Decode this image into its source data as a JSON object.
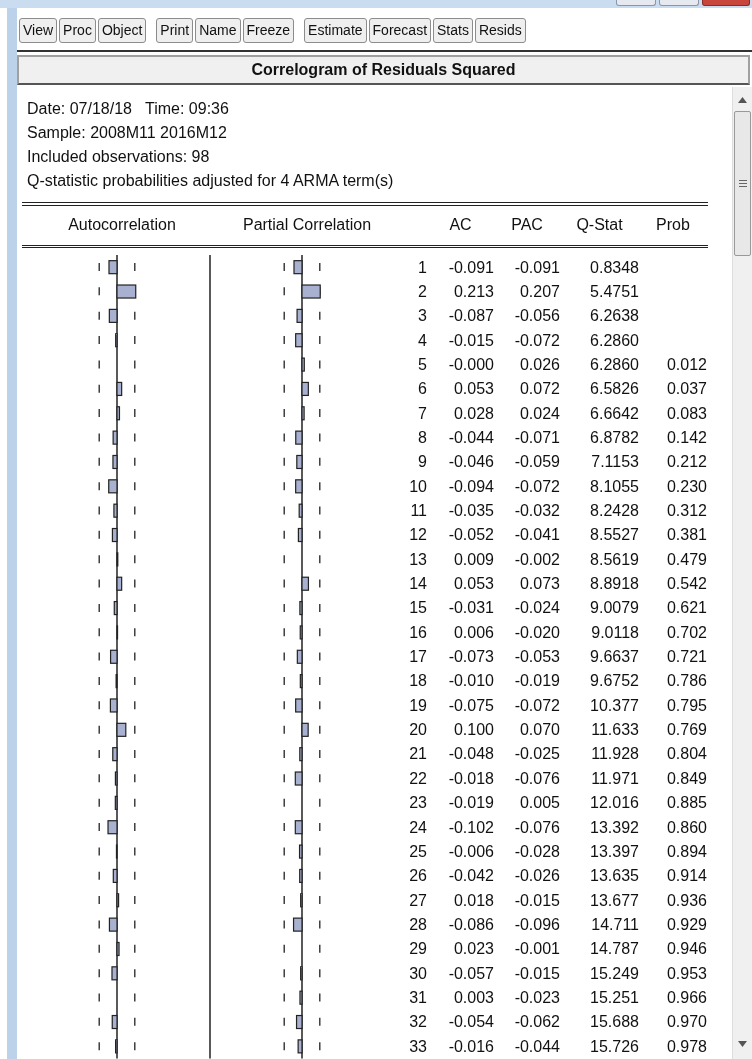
{
  "toolbar": {
    "groups": [
      [
        "View",
        "Proc",
        "Object"
      ],
      [
        "Print",
        "Name",
        "Freeze"
      ],
      [
        "Estimate",
        "Forecast",
        "Stats",
        "Resids"
      ]
    ]
  },
  "title": "Correlogram of Residuals Squared",
  "info": [
    "Date: 07/18/18   Time: 09:36",
    "Sample: 2008M11 2016M12",
    "Included observations: 98",
    "Q-statistic probabilities adjusted for 4 ARMA term(s)"
  ],
  "columns": [
    "Autocorrelation",
    "Partial Correlation",
    "AC",
    "PAC",
    "Q-Stat",
    "Prob"
  ],
  "rows": [
    {
      "lag": "1",
      "ac": "-0.091",
      "pac": "-0.091",
      "q_stat": "0.8348"
    },
    {
      "lag": "2",
      "ac": "0.213",
      "pac": "0.207",
      "q_stat": "5.4751"
    },
    {
      "lag": "3",
      "ac": "-0.087",
      "pac": "-0.056",
      "q_stat": "6.2638"
    },
    {
      "lag": "4",
      "ac": "-0.015",
      "pac": "-0.072",
      "q_stat": "6.2860"
    },
    {
      "lag": "5",
      "ac": "-0.000",
      "pac": "0.026",
      "q_stat": "6.2860",
      "prob": "0.012"
    },
    {
      "lag": "6",
      "ac": "0.053",
      "pac": "0.072",
      "q_stat": "6.5826",
      "prob": "0.037"
    },
    {
      "lag": "7",
      "ac": "0.028",
      "pac": "0.024",
      "q_stat": "6.6642",
      "prob": "0.083"
    },
    {
      "lag": "8",
      "ac": "-0.044",
      "pac": "-0.071",
      "q_stat": "6.8782",
      "prob": "0.142"
    },
    {
      "lag": "9",
      "ac": "-0.046",
      "pac": "-0.059",
      "q_stat": "7.1153",
      "prob": "0.212"
    },
    {
      "lag": "10",
      "ac": "-0.094",
      "pac": "-0.072",
      "q_stat": "8.1055",
      "prob": "0.230"
    },
    {
      "lag": "11",
      "ac": "-0.035",
      "pac": "-0.032",
      "q_stat": "8.2428",
      "prob": "0.312"
    },
    {
      "lag": "12",
      "ac": "-0.052",
      "pac": "-0.041",
      "q_stat": "8.5527",
      "prob": "0.381"
    },
    {
      "lag": "13",
      "ac": "0.009",
      "pac": "-0.002",
      "q_stat": "8.5619",
      "prob": "0.479"
    },
    {
      "lag": "14",
      "ac": "0.053",
      "pac": "0.073",
      "q_stat": "8.8918",
      "prob": "0.542"
    },
    {
      "lag": "15",
      "ac": "-0.031",
      "pac": "-0.024",
      "q_stat": "9.0079",
      "prob": "0.621"
    },
    {
      "lag": "16",
      "ac": "0.006",
      "pac": "-0.020",
      "q_stat": "9.0118",
      "prob": "0.702"
    },
    {
      "lag": "17",
      "ac": "-0.073",
      "pac": "-0.053",
      "q_stat": "9.6637",
      "prob": "0.721"
    },
    {
      "lag": "18",
      "ac": "-0.010",
      "pac": "-0.019",
      "q_stat": "9.6752",
      "prob": "0.786"
    },
    {
      "lag": "19",
      "ac": "-0.075",
      "pac": "-0.072",
      "q_stat": "10.377",
      "prob": "0.795"
    },
    {
      "lag": "20",
      "ac": "0.100",
      "pac": "0.070",
      "q_stat": "11.633",
      "prob": "0.769"
    },
    {
      "lag": "21",
      "ac": "-0.048",
      "pac": "-0.025",
      "q_stat": "11.928",
      "prob": "0.804"
    },
    {
      "lag": "22",
      "ac": "-0.018",
      "pac": "-0.076",
      "q_stat": "11.971",
      "prob": "0.849"
    },
    {
      "lag": "23",
      "ac": "-0.019",
      "pac": "0.005",
      "q_stat": "12.016",
      "prob": "0.885"
    },
    {
      "lag": "24",
      "ac": "-0.102",
      "pac": "-0.076",
      "q_stat": "13.392",
      "prob": "0.860"
    },
    {
      "lag": "25",
      "ac": "-0.006",
      "pac": "-0.028",
      "q_stat": "13.397",
      "prob": "0.894"
    },
    {
      "lag": "26",
      "ac": "-0.042",
      "pac": "-0.026",
      "q_stat": "13.635",
      "prob": "0.914"
    },
    {
      "lag": "27",
      "ac": "0.018",
      "pac": "-0.015",
      "q_stat": "13.677",
      "prob": "0.936"
    },
    {
      "lag": "28",
      "ac": "-0.086",
      "pac": "-0.096",
      "q_stat": "14.711",
      "prob": "0.929"
    },
    {
      "lag": "29",
      "ac": "0.023",
      "pac": "-0.001",
      "q_stat": "14.787",
      "prob": "0.946"
    },
    {
      "lag": "30",
      "ac": "-0.057",
      "pac": "-0.015",
      "q_stat": "15.249",
      "prob": "0.953"
    },
    {
      "lag": "31",
      "ac": "0.003",
      "pac": "-0.023",
      "q_stat": "15.251",
      "prob": "0.966"
    },
    {
      "lag": "32",
      "ac": "-0.054",
      "pac": "-0.062",
      "q_stat": "15.688",
      "prob": "0.970"
    },
    {
      "lag": "33",
      "ac": "-0.016",
      "pac": "-0.044",
      "q_stat": "15.726",
      "prob": "0.978"
    }
  ]
}
